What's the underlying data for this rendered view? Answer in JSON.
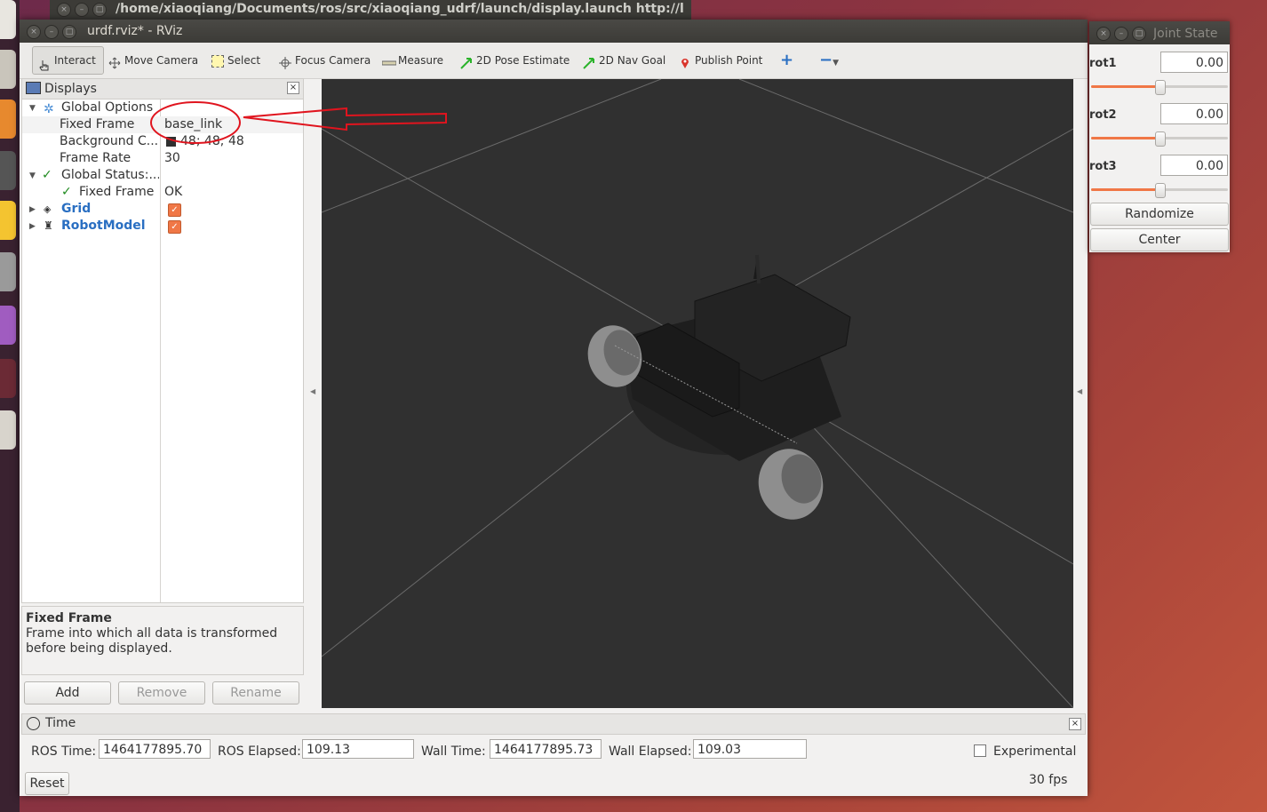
{
  "terminal": {
    "title": "/home/xiaoqiang/Documents/ros/src/xiaoqiang_udrf/launch/display.launch http://localhos"
  },
  "rviz": {
    "window_title": "urdf.rviz* - RViz",
    "toolbar": {
      "interact": "Interact",
      "move_camera": "Move Camera",
      "select": "Select",
      "focus_camera": "Focus Camera",
      "measure": "Measure",
      "pose_estimate": "2D Pose Estimate",
      "nav_goal": "2D Nav Goal",
      "publish_point": "Publish Point"
    },
    "displays": {
      "title": "Displays",
      "global_options": "Global Options",
      "fixed_frame_key": "Fixed Frame",
      "fixed_frame_value": "base_link",
      "background_key": "Background C...",
      "background_value": "48; 48; 48",
      "frame_rate_key": "Frame Rate",
      "frame_rate_value": "30",
      "global_status": "Global Status:...",
      "status_fixed_frame": "Fixed Frame",
      "status_ok": "OK",
      "grid": "Grid",
      "robot_model": "RobotModel"
    },
    "description": {
      "heading": "Fixed Frame",
      "body": "Frame into which all data is transformed before being displayed."
    },
    "buttons": {
      "add": "Add",
      "remove": "Remove",
      "rename": "Rename"
    },
    "time": {
      "title": "Time",
      "ros_time_label": "ROS Time:",
      "ros_time": "1464177895.70",
      "ros_elapsed_label": "ROS Elapsed:",
      "ros_elapsed": "109.13",
      "wall_time_label": "Wall Time:",
      "wall_time": "1464177895.73",
      "wall_elapsed_label": "Wall Elapsed:",
      "wall_elapsed": "109.03",
      "experimental": "Experimental",
      "reset": "Reset",
      "fps": "30 fps"
    },
    "colors": {
      "view_background": "#303030",
      "accent": "#f07746",
      "annotation": "#e0141e"
    }
  },
  "joint_state": {
    "title": "Joint State",
    "joints": [
      {
        "name": "rot1",
        "value": "0.00",
        "level": 0.5
      },
      {
        "name": "rot2",
        "value": "0.00",
        "level": 0.5
      },
      {
        "name": "rot3",
        "value": "0.00",
        "level": 0.5
      }
    ],
    "randomize": "Randomize",
    "center": "Center"
  }
}
